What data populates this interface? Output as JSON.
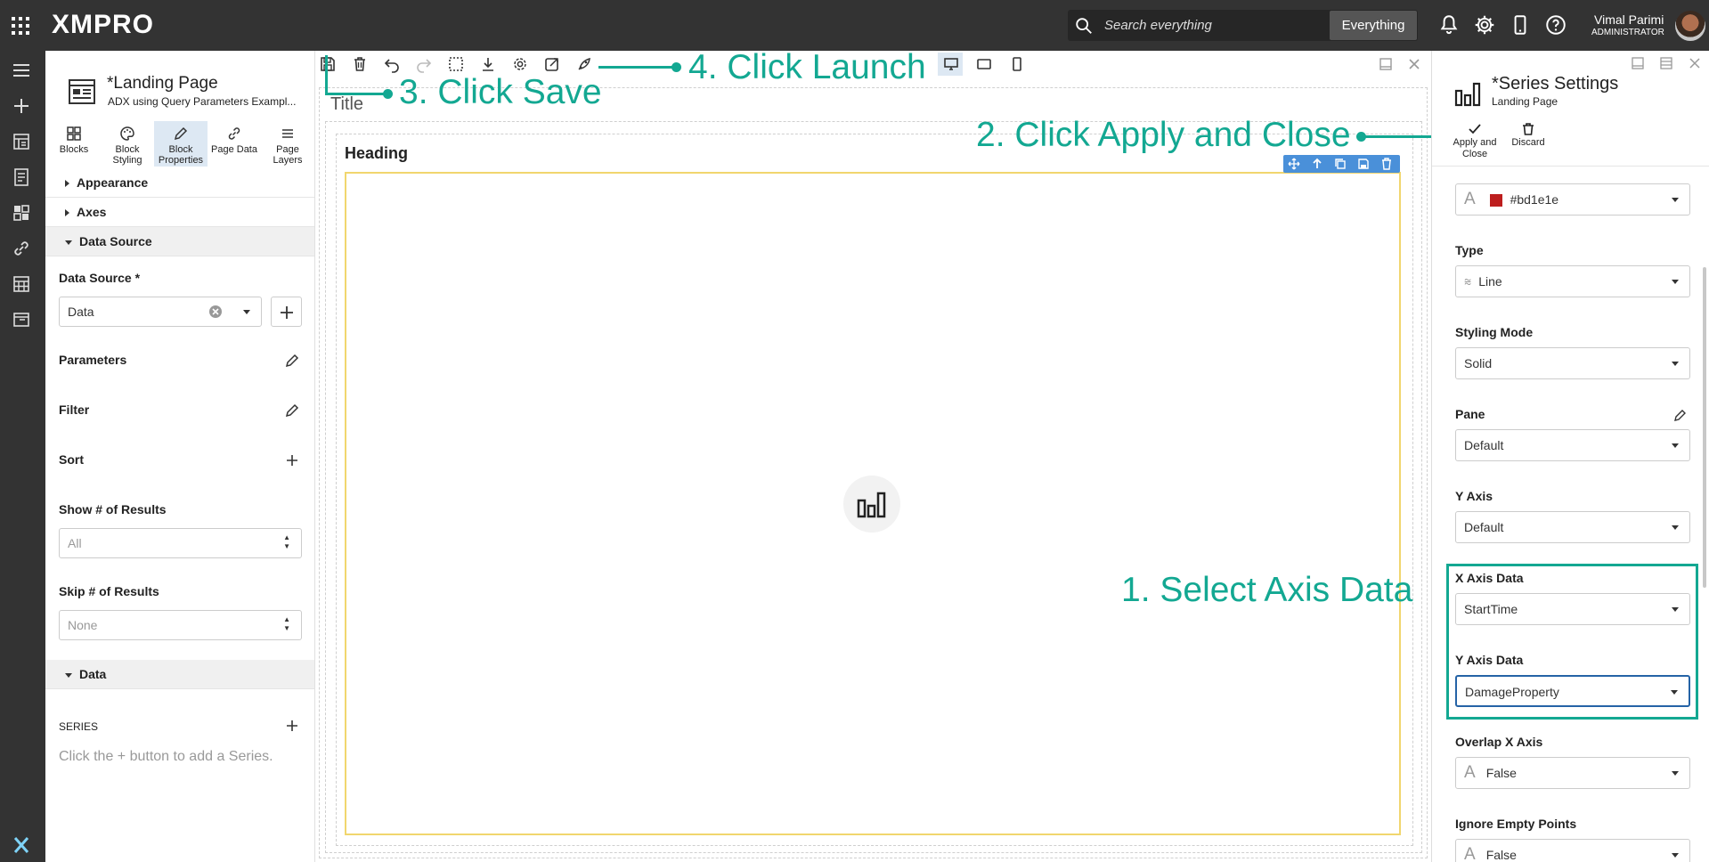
{
  "topbar": {
    "brand": "XMPRO",
    "search_placeholder": "Search everything",
    "search_scope": "Everything",
    "user_name": "Vimal Parimi",
    "user_role": "ADMINISTRATOR"
  },
  "left_panel": {
    "page_title": "*Landing Page",
    "page_subtitle": "ADX using Query Parameters Exampl...",
    "tabs": [
      {
        "label": "Blocks"
      },
      {
        "label": "Block Styling"
      },
      {
        "label": "Block Properties"
      },
      {
        "label": "Page Data"
      },
      {
        "label": "Page Layers"
      }
    ],
    "sections": {
      "appearance": "Appearance",
      "axes": "Axes",
      "data_source": "Data Source",
      "data": "Data"
    },
    "data_source_label": "Data Source *",
    "data_source_value": "Data",
    "parameters_label": "Parameters",
    "filter_label": "Filter",
    "sort_label": "Sort",
    "show_results_label": "Show # of Results",
    "show_results_value": "All",
    "skip_results_label": "Skip # of Results",
    "skip_results_value": "None",
    "series_label": "SERIES",
    "series_hint": "Click the + button to add a Series."
  },
  "canvas": {
    "title_text": "Title",
    "heading_text": "Heading"
  },
  "annotations": {
    "step1": "1. Select Axis Data",
    "step2": "2. Click Apply and Close",
    "step3": "3. Click Save",
    "step4": "4. Click Launch"
  },
  "right_panel": {
    "title": "*Series Settings",
    "subtitle": "Landing Page",
    "apply_label": "Apply and Close",
    "discard_label": "Discard",
    "color_value": "#bd1e1e",
    "type_label": "Type",
    "type_value": "Line",
    "styling_mode_label": "Styling Mode",
    "styling_mode_value": "Solid",
    "pane_label": "Pane",
    "pane_value": "Default",
    "y_axis_label": "Y Axis",
    "y_axis_value": "Default",
    "x_axis_data_label": "X Axis Data",
    "x_axis_data_value": "StartTime",
    "y_axis_data_label": "Y Axis Data",
    "y_axis_data_value": "DamageProperty",
    "overlap_x_label": "Overlap X Axis",
    "overlap_x_value": "False",
    "ignore_empty_label": "Ignore Empty Points",
    "ignore_empty_value": "False"
  },
  "colors": {
    "accent": "#13a892",
    "series_color": "#bd1e1e",
    "topbar": "#333333",
    "selection": "#f1d66e"
  }
}
